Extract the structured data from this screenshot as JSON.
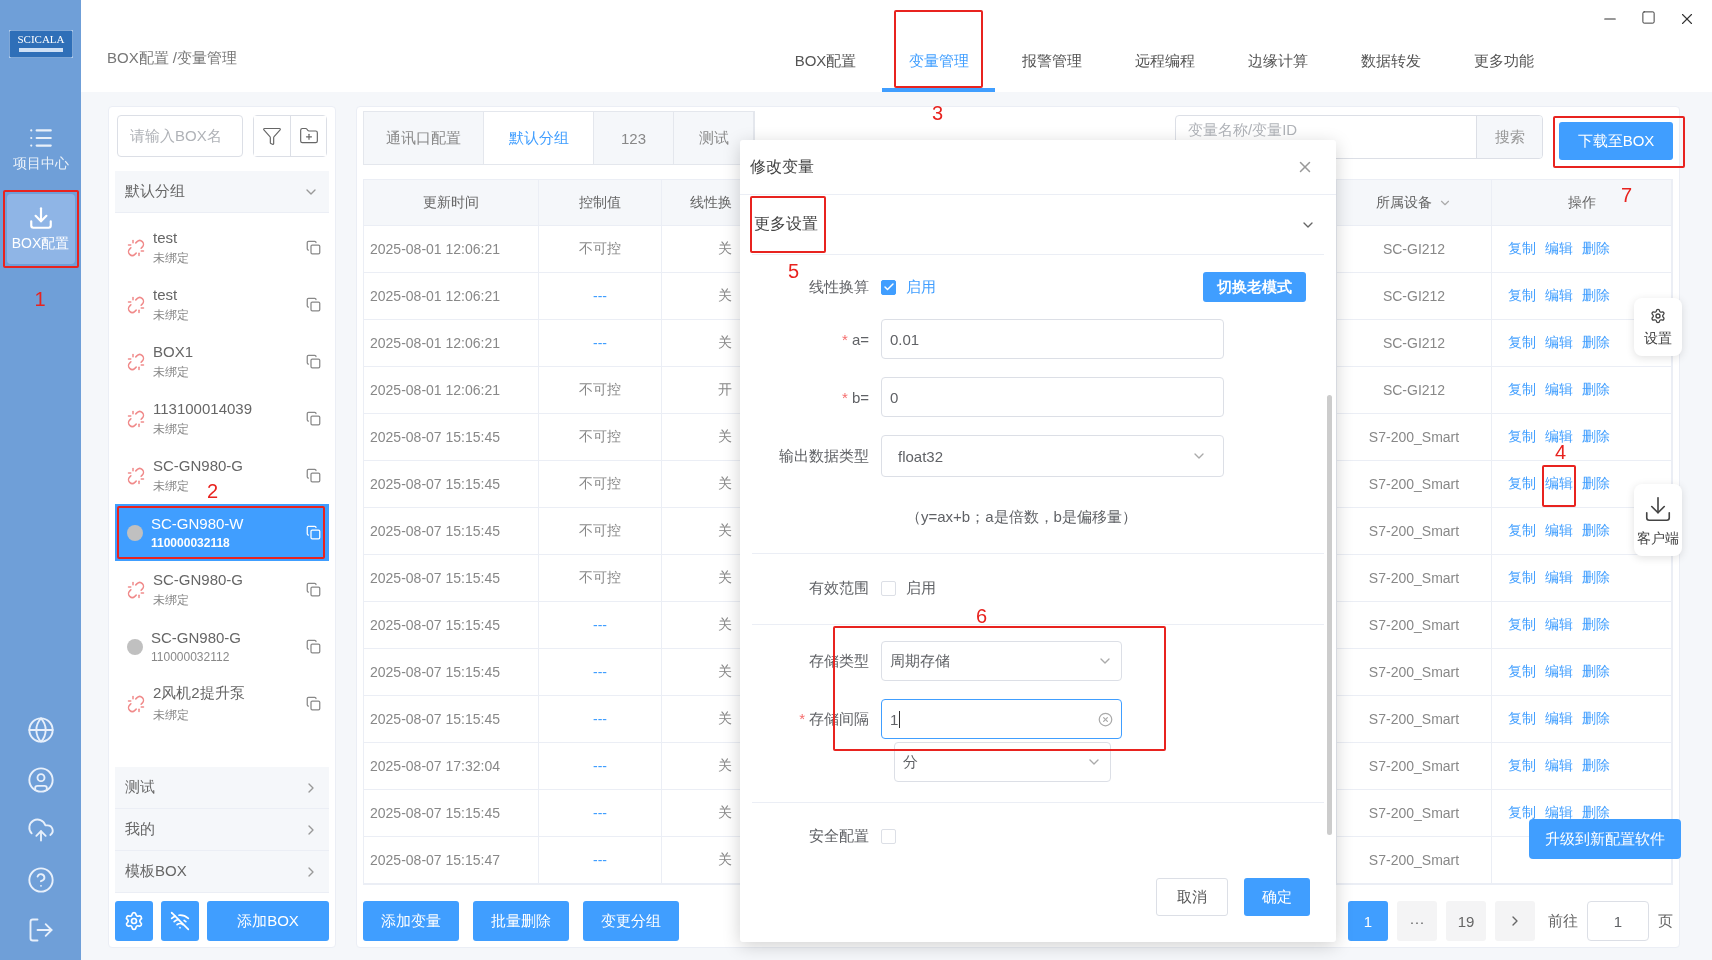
{
  "nav": {
    "logo": "SCICALA",
    "items": [
      {
        "label": "项目中心",
        "selected": false
      },
      {
        "label": "BOX配置",
        "selected": true,
        "annotation": "1"
      }
    ]
  },
  "header": {
    "breadcrumb": "BOX配置 /变量管理",
    "tabs": [
      {
        "label": "BOX配置",
        "selected": false
      },
      {
        "label": "变量管理",
        "selected": true,
        "annotation": "3"
      },
      {
        "label": "报警管理",
        "selected": false
      },
      {
        "label": "远程编程",
        "selected": false
      },
      {
        "label": "边缘计算",
        "selected": false
      },
      {
        "label": "数据转发",
        "selected": false
      },
      {
        "label": "更多功能",
        "selected": false
      }
    ]
  },
  "device_panel": {
    "search": {
      "placeholder": "请输入BOX名"
    },
    "groups": [
      {
        "name": "默认分组",
        "expanded": true,
        "devices": [
          {
            "name": "test",
            "sub": "未绑定",
            "bound": false,
            "selected": false
          },
          {
            "name": "test",
            "sub": "未绑定",
            "bound": false,
            "selected": false
          },
          {
            "name": "BOX1",
            "sub": "未绑定",
            "bound": false,
            "selected": false
          },
          {
            "name": "113100014039",
            "sub": "未绑定",
            "bound": false,
            "selected": false
          },
          {
            "name": "SC-GN980-G",
            "sub": "未绑定",
            "bound": false,
            "selected": false
          },
          {
            "name": "SC-GN980-W",
            "sub": "110000032118",
            "bound": true,
            "selected": true,
            "annotation": "2"
          },
          {
            "name": "SC-GN980-G",
            "sub": "未绑定",
            "bound": false,
            "selected": false
          },
          {
            "name": "SC-GN980-G",
            "sub": "110000032112",
            "bound": true,
            "selected": false
          },
          {
            "name": "2风机2提升泵",
            "sub": "未绑定",
            "bound": false,
            "selected": false
          }
        ]
      },
      {
        "name": "测试",
        "expanded": false
      },
      {
        "name": "我的",
        "expanded": false
      },
      {
        "name": "模板BOX",
        "expanded": false
      }
    ],
    "add_button": "添加BOX"
  },
  "main": {
    "tabs": [
      {
        "label": "通讯口配置",
        "selected": false
      },
      {
        "label": "默认分组",
        "selected": true
      },
      {
        "label": "123",
        "selected": false
      },
      {
        "label": "测试",
        "selected": false
      }
    ],
    "search": {
      "placeholder": "变量名称/变量ID"
    },
    "search_button": "搜索",
    "download_button": {
      "label": "下载至BOX",
      "annotation": "7"
    },
    "table": {
      "columns": [
        {
          "label": "更新时间"
        },
        {
          "label": "控制值"
        },
        {
          "label": "线性换"
        },
        {
          "label": "所属设备",
          "filter": true
        },
        {
          "label": "操作"
        }
      ],
      "rows": [
        {
          "time": "2025-08-01 12:06:21",
          "control": "不可控",
          "control_empty": false,
          "linear": "关",
          "device": "SC-GI212",
          "actions": [
            "复制",
            "编辑",
            "删除"
          ]
        },
        {
          "time": "2025-08-01 12:06:21",
          "control": "---",
          "control_empty": true,
          "linear": "关",
          "device": "SC-GI212",
          "actions": [
            "复制",
            "编辑",
            "删除"
          ]
        },
        {
          "time": "2025-08-01 12:06:21",
          "control": "---",
          "control_empty": true,
          "linear": "关",
          "device": "SC-GI212",
          "actions": [
            "复制",
            "编辑",
            "删除"
          ]
        },
        {
          "time": "2025-08-01 12:06:21",
          "control": "不可控",
          "control_empty": false,
          "linear": "开",
          "device": "SC-GI212",
          "actions": [
            "复制",
            "编辑",
            "删除"
          ]
        },
        {
          "time": "2025-08-07 15:15:45",
          "control": "不可控",
          "control_empty": false,
          "linear": "关",
          "device": "S7-200_Smart",
          "actions": [
            "复制",
            "编辑",
            "删除"
          ]
        },
        {
          "time": "2025-08-07 15:15:45",
          "control": "不可控",
          "control_empty": false,
          "linear": "关",
          "device": "S7-200_Smart",
          "actions": [
            "复制",
            "编辑",
            "删除"
          ],
          "annotation": "4"
        },
        {
          "time": "2025-08-07 15:15:45",
          "control": "不可控",
          "control_empty": false,
          "linear": "关",
          "device": "S7-200_Smart",
          "actions": [
            "复制",
            "编辑",
            "删除"
          ]
        },
        {
          "time": "2025-08-07 15:15:45",
          "control": "不可控",
          "control_empty": false,
          "linear": "关",
          "device": "S7-200_Smart",
          "actions": [
            "复制",
            "编辑",
            "删除"
          ]
        },
        {
          "time": "2025-08-07 15:15:45",
          "control": "---",
          "control_empty": true,
          "linear": "关",
          "device": "S7-200_Smart",
          "actions": [
            "复制",
            "编辑",
            "删除"
          ]
        },
        {
          "time": "2025-08-07 15:15:45",
          "control": "---",
          "control_empty": true,
          "linear": "关",
          "device": "S7-200_Smart",
          "actions": [
            "复制",
            "编辑",
            "删除"
          ]
        },
        {
          "time": "2025-08-07 15:15:45",
          "control": "---",
          "control_empty": true,
          "linear": "关",
          "device": "S7-200_Smart",
          "actions": [
            "复制",
            "编辑",
            "删除"
          ]
        },
        {
          "time": "2025-08-07 17:32:04",
          "control": "---",
          "control_empty": true,
          "linear": "关",
          "device": "S7-200_Smart",
          "actions": [
            "复制",
            "编辑",
            "删除"
          ]
        },
        {
          "time": "2025-08-07 15:15:45",
          "control": "---",
          "control_empty": true,
          "linear": "关",
          "device": "S7-200_Smart",
          "actions": [
            "复制",
            "编辑",
            "删除"
          ]
        },
        {
          "time": "2025-08-07 15:15:47",
          "control": "---",
          "control_empty": true,
          "linear": "关",
          "device": "S7-200_Smart"
        }
      ]
    },
    "bottom_buttons": [
      "添加变量",
      "批量删除",
      "变更分组"
    ],
    "pagination": {
      "current": "1",
      "ellipsis": "···",
      "last": "19",
      "goto_label": "前往",
      "goto_value": "1",
      "goto_suffix": "页"
    },
    "upgrade_button": "升级到新配置软件",
    "side_widgets": [
      {
        "kind": "settings",
        "label": "设置"
      },
      {
        "kind": "client",
        "label": "客户端"
      }
    ]
  },
  "modal": {
    "title": "修改变量",
    "section": {
      "title": "更多设置",
      "expanded": true,
      "annotation": "5"
    },
    "linear": {
      "label": "线性换算",
      "checked": true,
      "check_label": "启用",
      "switch_button": "切换老模式"
    },
    "fields": [
      {
        "label": "a=",
        "value": "0.01",
        "required_mark": "*"
      },
      {
        "label": "b=",
        "value": "0",
        "required_mark": "*"
      }
    ],
    "output_type": {
      "label": "输出数据类型",
      "value": "float32"
    },
    "hint": "（y=ax+b；a是倍数，b是偏移量）",
    "valid_range": {
      "label": "有效范围",
      "checked": false,
      "check_label": "启用"
    },
    "storage": {
      "annotation": "6",
      "type_label": "存储类型",
      "type_value": "周期存储",
      "interval_label": "存储间隔",
      "interval_required_mark": "*",
      "interval_value": "1",
      "interval_focused": true,
      "unit": "分"
    },
    "security": {
      "label": "安全配置",
      "checked": false
    },
    "buttons": {
      "cancel": "取消",
      "confirm": "确定"
    }
  }
}
